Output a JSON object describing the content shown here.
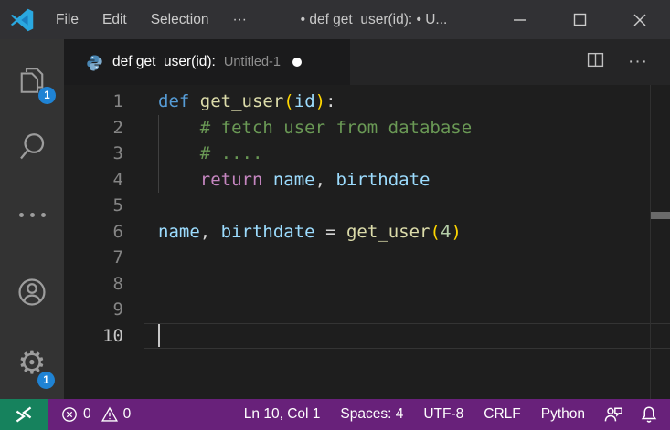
{
  "colors": {
    "titlebar-bg": "#313134",
    "activity-bg": "#333333",
    "tabbar-bg": "#252526",
    "tab-bg": "#1b1b1c",
    "editor-bg": "#1e1e1e",
    "status-bg": "#68217A",
    "remote-bg": "#16825D",
    "badge-bg": "#1f83d4"
  },
  "syntax": {
    "kw": "#569cd6",
    "kw2": "#c586c0",
    "fn": "#dcdcaa",
    "var": "#9cdcfe",
    "pl": "#d4d4d4",
    "cm": "#6a9955",
    "br": "#ffd700",
    "num": "#b5cea8"
  },
  "window": {
    "title": "• def get_user(id): • U...",
    "menus": [
      {
        "id": "file",
        "label": "File"
      },
      {
        "id": "edit",
        "label": "Edit"
      },
      {
        "id": "selection",
        "label": "Selection"
      },
      {
        "id": "more",
        "label": "···"
      }
    ]
  },
  "activity_bar": {
    "explorer_badge": "1",
    "settings_badge": "1"
  },
  "icons": {
    "settings_gear": "⚙",
    "more_actions": "···"
  },
  "tab": {
    "label": "def get_user(id):",
    "description": "Untitled-1"
  },
  "editor": {
    "lines": [
      {
        "num": "1",
        "tokens": [
          {
            "t": "def",
            "c": "kw"
          },
          {
            "t": " ",
            "c": "pl"
          },
          {
            "t": "get_user",
            "c": "fn"
          },
          {
            "t": "(",
            "c": "br"
          },
          {
            "t": "id",
            "c": "var"
          },
          {
            "t": ")",
            "c": "br"
          },
          {
            "t": ":",
            "c": "pl"
          }
        ]
      },
      {
        "num": "2",
        "tokens": [
          {
            "t": "    # fetch user from database",
            "c": "cm"
          }
        ]
      },
      {
        "num": "3",
        "tokens": [
          {
            "t": "    # ....",
            "c": "cm"
          }
        ]
      },
      {
        "num": "4",
        "tokens": [
          {
            "t": "    ",
            "c": "pl"
          },
          {
            "t": "return",
            "c": "kw2"
          },
          {
            "t": " ",
            "c": "pl"
          },
          {
            "t": "name",
            "c": "var"
          },
          {
            "t": ",",
            "c": "pl"
          },
          {
            "t": " ",
            "c": "pl"
          },
          {
            "t": "birthdate",
            "c": "var"
          }
        ]
      },
      {
        "num": "5",
        "tokens": []
      },
      {
        "num": "6",
        "tokens": [
          {
            "t": "name",
            "c": "var"
          },
          {
            "t": ",",
            "c": "pl"
          },
          {
            "t": " ",
            "c": "pl"
          },
          {
            "t": "birthdate",
            "c": "var"
          },
          {
            "t": " ",
            "c": "pl"
          },
          {
            "t": "=",
            "c": "pl"
          },
          {
            "t": " ",
            "c": "pl"
          },
          {
            "t": "get_user",
            "c": "fn"
          },
          {
            "t": "(",
            "c": "br"
          },
          {
            "t": "4",
            "c": "num"
          },
          {
            "t": ")",
            "c": "br"
          }
        ]
      },
      {
        "num": "7",
        "tokens": []
      },
      {
        "num": "8",
        "tokens": []
      },
      {
        "num": "9",
        "tokens": []
      },
      {
        "num": "10",
        "tokens": [],
        "active": true
      }
    ]
  },
  "status_bar": {
    "errors": "0",
    "warnings": "0",
    "items": [
      {
        "id": "cursor-position",
        "label": "Ln 10, Col 1"
      },
      {
        "id": "indentation",
        "label": "Spaces: 4"
      },
      {
        "id": "encoding",
        "label": "UTF-8"
      },
      {
        "id": "end-of-line",
        "label": "CRLF"
      },
      {
        "id": "language-mode",
        "label": "Python"
      }
    ]
  }
}
